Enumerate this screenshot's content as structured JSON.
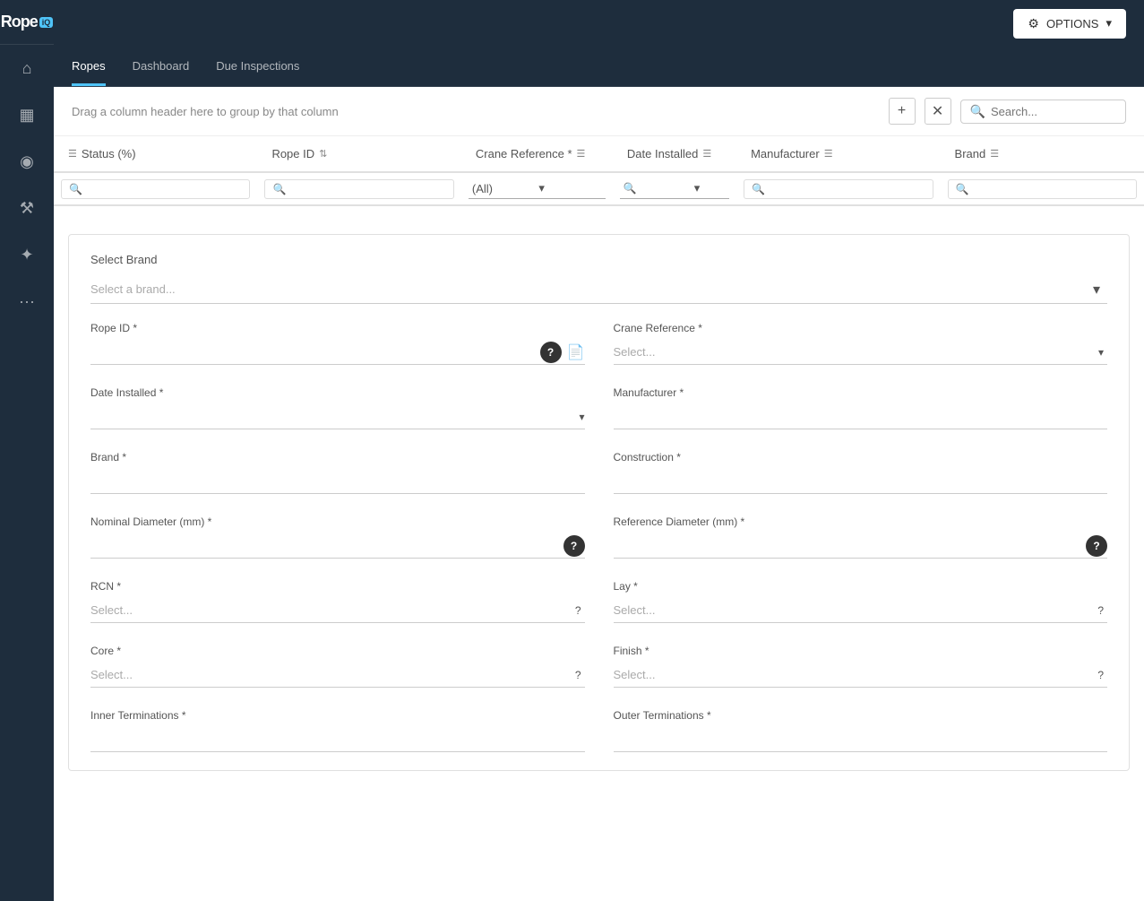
{
  "app": {
    "logo_text": "Rope",
    "logo_badge": "iQ",
    "options_label": "OPTIONS"
  },
  "sidebar": {
    "icons": [
      {
        "name": "home-icon",
        "symbol": "⌂"
      },
      {
        "name": "grid-icon",
        "symbol": "▦"
      },
      {
        "name": "eye-icon",
        "symbol": "◉"
      },
      {
        "name": "tool-icon",
        "symbol": "⚒"
      },
      {
        "name": "plugin-icon",
        "symbol": "✦"
      },
      {
        "name": "more-icon",
        "symbol": "···"
      }
    ]
  },
  "nav_tabs": [
    {
      "label": "Ropes",
      "active": true
    },
    {
      "label": "Dashboard",
      "active": false
    },
    {
      "label": "Due Inspections",
      "active": false
    }
  ],
  "toolbar": {
    "drag_hint": "Drag a column header here to group by that column",
    "add_label": "+",
    "clear_label": "✕",
    "search_placeholder": "Search..."
  },
  "table": {
    "columns": [
      {
        "label": "Status (%)",
        "filter": true
      },
      {
        "label": "Rope ID",
        "filter": true
      },
      {
        "label": "Crane Reference",
        "filter": true,
        "has_dropdown": true
      },
      {
        "label": "Date Installed",
        "filter": true,
        "has_dropdown": true
      },
      {
        "label": "Manufacturer",
        "filter": true
      },
      {
        "label": "Brand",
        "filter": true
      }
    ],
    "filter_dropdown_value": "(All)"
  },
  "form": {
    "select_brand_label": "Select Brand",
    "select_brand_placeholder": "Select a brand...",
    "rope_id_label": "Rope ID *",
    "crane_reference_label": "Crane Reference *",
    "crane_reference_placeholder": "Select...",
    "date_installed_label": "Date Installed *",
    "manufacturer_label": "Manufacturer *",
    "brand_label": "Brand *",
    "construction_label": "Construction *",
    "nominal_diameter_label": "Nominal Diameter (mm) *",
    "reference_diameter_label": "Reference Diameter (mm) *",
    "rcn_label": "RCN *",
    "rcn_placeholder": "Select...",
    "lay_label": "Lay *",
    "lay_placeholder": "Select...",
    "core_label": "Core *",
    "core_placeholder": "Select...",
    "finish_label": "Finish *",
    "finish_placeholder": "Select...",
    "inner_terminations_label": "Inner Terminations *",
    "outer_terminations_label": "Outer Terminations *"
  }
}
